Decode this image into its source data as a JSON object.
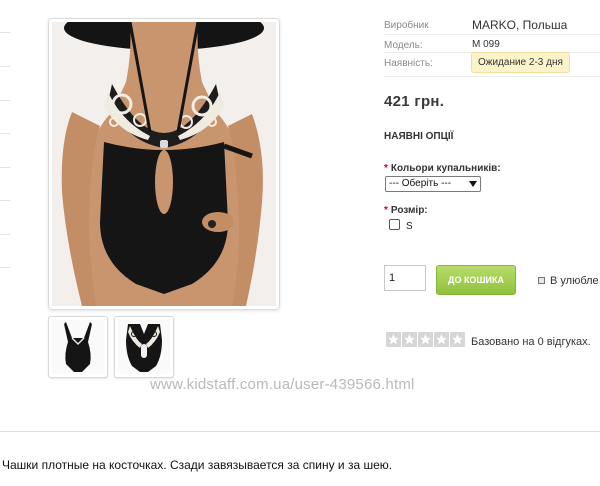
{
  "product": {
    "info": [
      {
        "label": "Виробник",
        "value": "MARKO, Польша"
      },
      {
        "label": "Модель:",
        "value": "M 099"
      },
      {
        "label": "Наявність:",
        "value": "Ожидание 2-3 дня"
      }
    ],
    "price": "421 грн.",
    "options_title": "НАЯВНІ ОПЦІЇ"
  },
  "options": {
    "color_label": "Кольори купальників:",
    "color_select_value": "--- Оберіть ---",
    "size_label": "Розмір:",
    "size_value": "S",
    "required_mark": "*"
  },
  "cart": {
    "quantity": "1",
    "add_button": "ДО КОШИКА",
    "wishlist": "В улюбле"
  },
  "rating": {
    "stars": 0,
    "reviews_text": "Базовано на 0 відгуках."
  },
  "watermark": "www.kidstaff.com.ua/user-439566.html",
  "description": "Чашки плотные на косточках. Сзади завязывается за спину и за шею.",
  "colors": {
    "cart_button": "#9ccb4a",
    "stock_badge_bg": "#fbf3c9",
    "required": "#d0001c"
  }
}
